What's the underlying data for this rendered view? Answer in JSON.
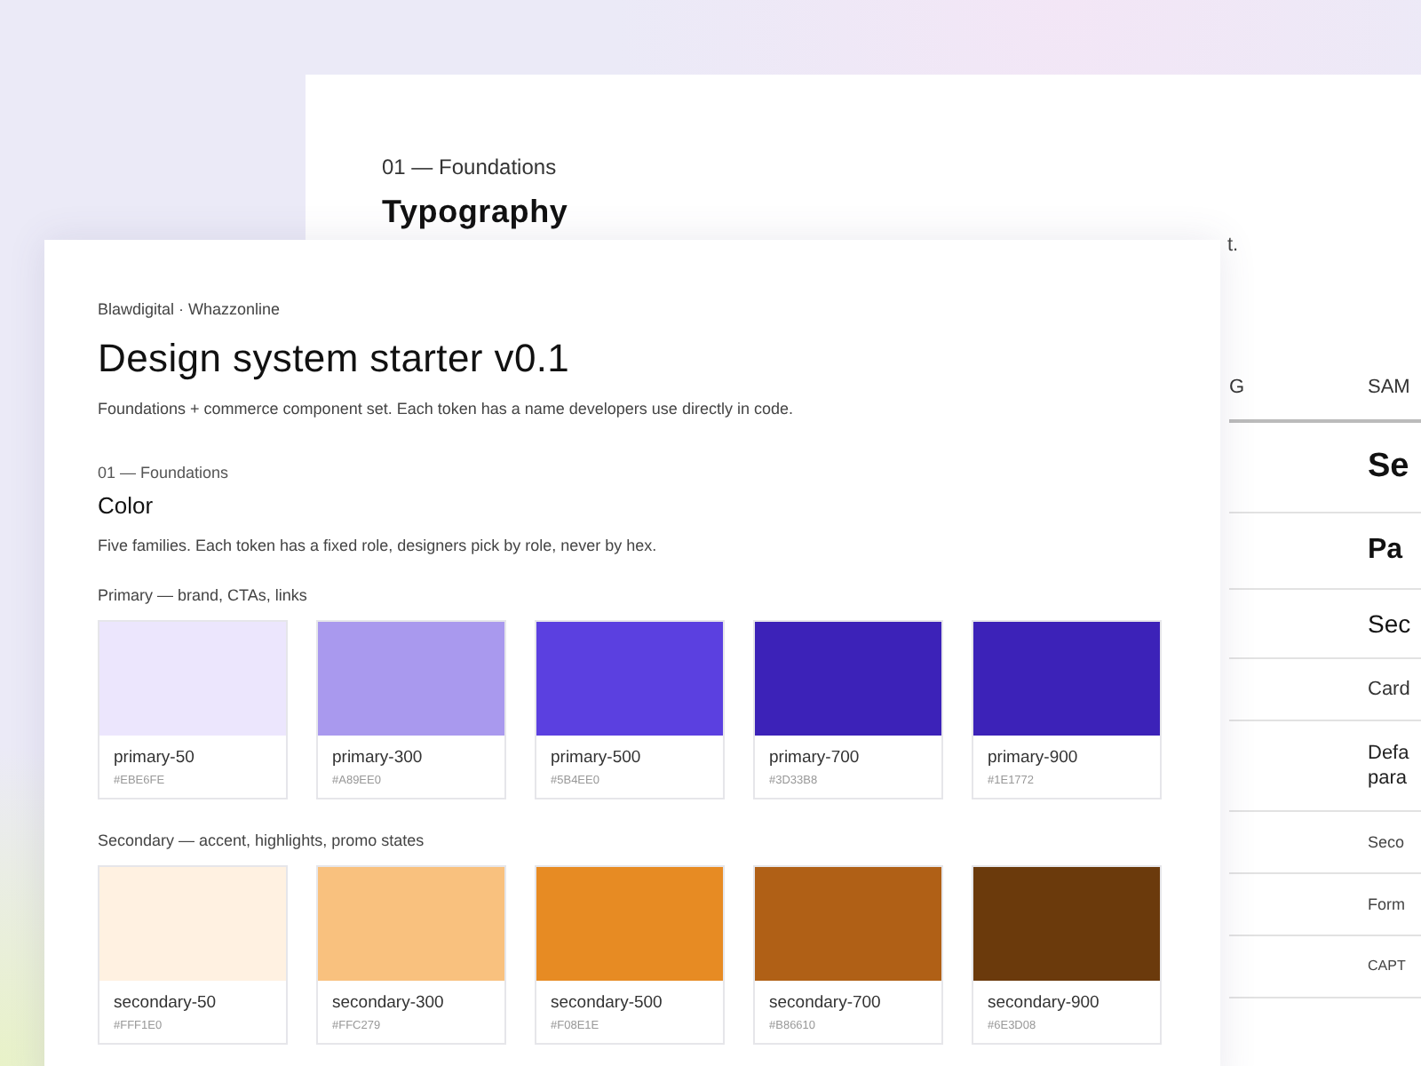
{
  "back_page": {
    "section_label": "01 — Foundations",
    "title": "Typography",
    "description_tail": "t.",
    "table": {
      "columns": [
        "G",
        "SAM"
      ],
      "rows": [
        {
          "kind": "display",
          "sample": "Se"
        },
        {
          "kind": "h1",
          "sample": "Pa"
        },
        {
          "kind": "h2",
          "sample": "Sec"
        },
        {
          "kind": "body-sm",
          "sample": "Card"
        },
        {
          "kind": "paragraph",
          "sample": "Defa\npara"
        },
        {
          "kind": "caption",
          "sample": "Seco"
        },
        {
          "kind": "label",
          "sample": "Form"
        },
        {
          "kind": "overline",
          "sample": "CAPT"
        }
      ]
    }
  },
  "front_page": {
    "brand": "Blawdigital · Whazzonline",
    "title": "Design system starter v0.1",
    "description": "Foundations + commerce component set. Each token has a name developers use directly in code.",
    "section_label": "01 — Foundations",
    "section_title": "Color",
    "section_description": "Five families. Each token has a fixed role, designers pick by role, never by hex.",
    "groups": [
      {
        "label": "Primary — brand, CTAs, links",
        "swatches": [
          {
            "name": "primary-50",
            "hex": "#EBE6FE",
            "color": "#ece6fd"
          },
          {
            "name": "primary-300",
            "hex": "#A89EE0",
            "color": "#a999ee"
          },
          {
            "name": "primary-500",
            "hex": "#5B4EE0",
            "color": "#5b40e0"
          },
          {
            "name": "primary-700",
            "hex": "#3D33B8",
            "color": "#3c22b8"
          },
          {
            "name": "primary-900",
            "hex": "#1E1772",
            "color": "#3c22b8"
          }
        ]
      },
      {
        "label": "Secondary — accent, highlights, promo states",
        "swatches": [
          {
            "name": "secondary-50",
            "hex": "#FFF1E0",
            "color": "#fff1e1"
          },
          {
            "name": "secondary-300",
            "hex": "#FFC279",
            "color": "#f9c17e"
          },
          {
            "name": "secondary-500",
            "hex": "#F08E1E",
            "color": "#e78b23"
          },
          {
            "name": "secondary-700",
            "hex": "#B86610",
            "color": "#b06016"
          },
          {
            "name": "secondary-900",
            "hex": "#6E3D08",
            "color": "#6b3a0c"
          }
        ]
      }
    ]
  }
}
